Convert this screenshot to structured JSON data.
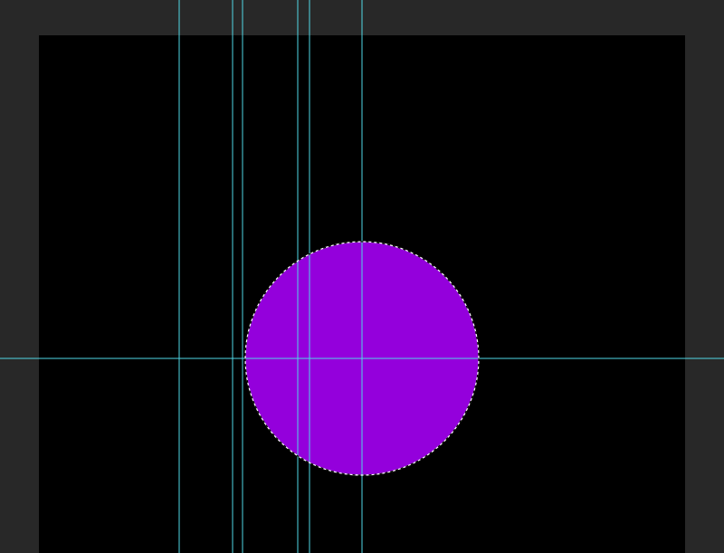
{
  "workspace": {
    "background_color": "#282828"
  },
  "document": {
    "canvas_color": "#000000"
  },
  "shape": {
    "type": "ellipse",
    "fill_color": "#9400DC",
    "selection": "marching-ants"
  },
  "guides": {
    "color": "#4fd7e6",
    "vertical_count": 7,
    "horizontal_count": 1
  }
}
